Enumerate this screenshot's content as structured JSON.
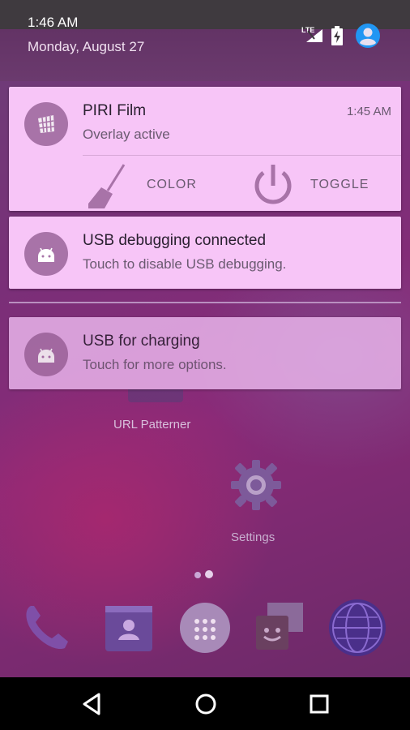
{
  "status_bar": {
    "time": "1:46 AM",
    "date": "Monday, August 27",
    "network": "LTE"
  },
  "notifications": [
    {
      "title": "PIRI Film",
      "text": "Overlay active",
      "time": "1:45 AM",
      "icon": "piri-film-icon",
      "actions": [
        {
          "label": "COLOR",
          "icon": "broom-icon"
        },
        {
          "label": "TOGGLE",
          "icon": "power-icon"
        }
      ]
    },
    {
      "title": "USB debugging connected",
      "text": "Touch to disable USB debugging.",
      "icon": "android-icon"
    },
    {
      "title": "USB for charging",
      "text": "Touch for more options.",
      "icon": "android-icon"
    }
  ],
  "launcher": {
    "apps": [
      {
        "label": "URL Patterner",
        "icon": "url-patterner-icon"
      },
      {
        "label": "Settings",
        "icon": "settings-gear-icon"
      }
    ],
    "dock": [
      "phone-icon",
      "contacts-icon",
      "app-drawer-icon",
      "messaging-icon",
      "browser-globe-icon"
    ]
  },
  "nav": [
    "back-icon",
    "home-icon",
    "recents-icon"
  ],
  "colors": {
    "notification_bg": "#f7c5f7",
    "accent_purple": "#a873a8",
    "status_bar": "#3f3a3f"
  }
}
